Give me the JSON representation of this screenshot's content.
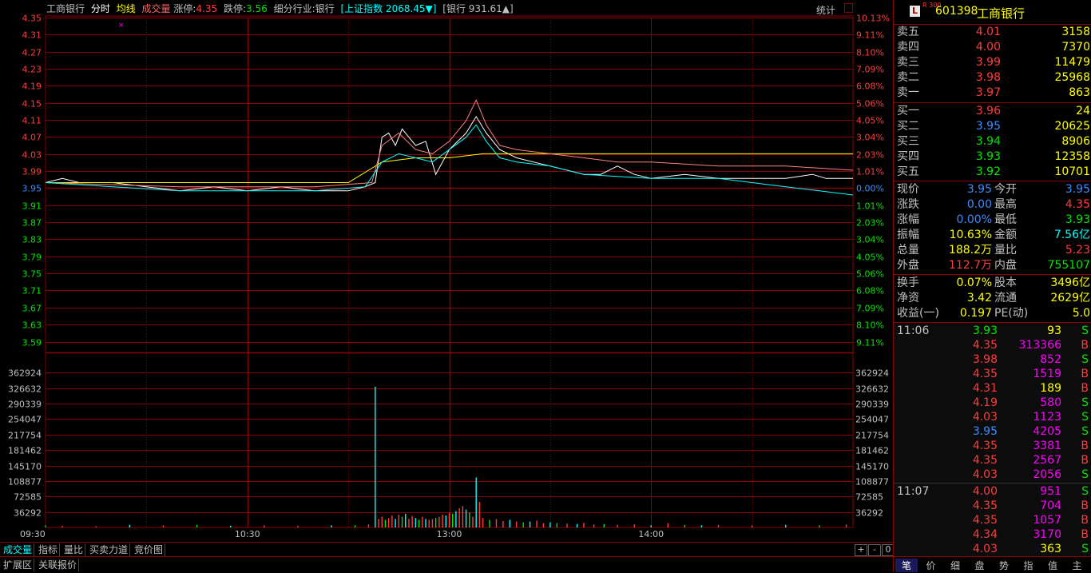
{
  "top": {
    "name": "工商银行",
    "mode": "分时",
    "avg_label": "均线",
    "vol_label": "成交量",
    "limit_up_label": "涨停:",
    "limit_up": "4.35",
    "limit_down_label": "跌停:",
    "limit_down": "3.56",
    "industry": "细分行业:银行",
    "index_text": "[上证指数 2068.45▼]",
    "sector_text": "[银行 931.61▲]",
    "stat_label": "统计"
  },
  "chart_data": {
    "type": "line",
    "title": "",
    "price_ticks": [
      "4.35",
      "4.31",
      "4.27",
      "4.23",
      "4.19",
      "4.15",
      "4.11",
      "4.07",
      "4.03",
      "3.99",
      "3.95",
      "3.91",
      "3.87",
      "3.83",
      "3.79",
      "3.75",
      "3.71",
      "3.67",
      "3.63",
      "3.59"
    ],
    "pct_ticks": [
      "10.13%",
      "9.11%",
      "8.10%",
      "7.09%",
      "6.08%",
      "5.06%",
      "4.05%",
      "3.04%",
      "2.03%",
      "1.01%",
      "0.00%",
      "1.01%",
      "2.03%",
      "3.04%",
      "4.05%",
      "5.06%",
      "6.08%",
      "7.09%",
      "8.10%",
      "9.11%"
    ],
    "vol_ticks": [
      "362924",
      "326632",
      "290339",
      "254047",
      "217754",
      "181462",
      "145170",
      "108877",
      "72585",
      "36292"
    ],
    "time_ticks": [
      "09:30",
      "10:30",
      "13:00",
      "14:00"
    ],
    "prev_close": 3.95,
    "price_range": [
      3.55,
      4.35
    ],
    "vol_range": [
      0,
      399216
    ],
    "minutes": 240,
    "series": [
      {
        "color": "#ffffff",
        "points": [
          [
            0,
            3.95
          ],
          [
            5,
            3.96
          ],
          [
            10,
            3.95
          ],
          [
            20,
            3.95
          ],
          [
            30,
            3.94
          ],
          [
            40,
            3.93
          ],
          [
            50,
            3.94
          ],
          [
            60,
            3.93
          ],
          [
            70,
            3.94
          ],
          [
            80,
            3.93
          ],
          [
            90,
            3.93
          ],
          [
            95,
            3.94
          ],
          [
            98,
            3.95
          ],
          [
            100,
            4.06
          ],
          [
            102,
            4.07
          ],
          [
            104,
            4.04
          ],
          [
            106,
            4.08
          ],
          [
            110,
            4.04
          ],
          [
            113,
            4.05
          ],
          [
            116,
            3.97
          ],
          [
            120,
            4.03
          ],
          [
            125,
            4.07
          ],
          [
            128,
            4.11
          ],
          [
            131,
            4.07
          ],
          [
            135,
            4.03
          ],
          [
            140,
            4.01
          ],
          [
            145,
            4.0
          ],
          [
            150,
            3.99
          ],
          [
            155,
            3.98
          ],
          [
            160,
            3.97
          ],
          [
            165,
            3.97
          ],
          [
            170,
            3.99
          ],
          [
            175,
            3.97
          ],
          [
            180,
            3.96
          ],
          [
            190,
            3.97
          ],
          [
            200,
            3.96
          ],
          [
            210,
            3.96
          ],
          [
            220,
            3.96
          ],
          [
            228,
            3.97
          ],
          [
            232,
            3.96
          ],
          [
            240,
            3.96
          ]
        ]
      },
      {
        "color": "#ffff00",
        "points": [
          [
            0,
            3.95
          ],
          [
            30,
            3.95
          ],
          [
            60,
            3.95
          ],
          [
            90,
            3.95
          ],
          [
            100,
            4.0
          ],
          [
            110,
            4.01
          ],
          [
            120,
            4.01
          ],
          [
            130,
            4.02
          ],
          [
            140,
            4.02
          ],
          [
            160,
            4.02
          ],
          [
            200,
            4.02
          ],
          [
            240,
            4.02
          ]
        ]
      },
      {
        "color": "#ff8080",
        "points": [
          [
            0,
            3.95
          ],
          [
            40,
            3.94
          ],
          [
            80,
            3.94
          ],
          [
            97,
            3.95
          ],
          [
            100,
            4.04
          ],
          [
            105,
            4.07
          ],
          [
            110,
            4.03
          ],
          [
            115,
            4.02
          ],
          [
            120,
            4.05
          ],
          [
            125,
            4.1
          ],
          [
            128,
            4.15
          ],
          [
            131,
            4.09
          ],
          [
            135,
            4.04
          ],
          [
            140,
            4.03
          ],
          [
            150,
            4.02
          ],
          [
            160,
            4.01
          ],
          [
            170,
            4.0
          ],
          [
            180,
            4.0
          ],
          [
            200,
            3.99
          ],
          [
            220,
            3.99
          ],
          [
            240,
            3.98
          ]
        ]
      },
      {
        "color": "#00ffff",
        "points": [
          [
            0,
            3.95
          ],
          [
            20,
            3.94
          ],
          [
            40,
            3.93
          ],
          [
            60,
            3.93
          ],
          [
            80,
            3.93
          ],
          [
            95,
            3.94
          ],
          [
            100,
            4.0
          ],
          [
            105,
            4.02
          ],
          [
            110,
            4.01
          ],
          [
            115,
            4.0
          ],
          [
            120,
            4.03
          ],
          [
            125,
            4.06
          ],
          [
            128,
            4.09
          ],
          [
            131,
            4.05
          ],
          [
            135,
            4.01
          ],
          [
            140,
            4.0
          ],
          [
            150,
            3.99
          ],
          [
            160,
            3.97
          ],
          [
            180,
            3.96
          ],
          [
            200,
            3.96
          ],
          [
            210,
            3.95
          ],
          [
            220,
            3.94
          ],
          [
            230,
            3.93
          ],
          [
            240,
            3.92
          ]
        ]
      }
    ],
    "volume": [
      [
        0,
        5000
      ],
      [
        5,
        4000
      ],
      [
        15,
        3000
      ],
      [
        25,
        6000
      ],
      [
        35,
        5000
      ],
      [
        45,
        6000
      ],
      [
        55,
        4000
      ],
      [
        65,
        5000
      ],
      [
        75,
        4000
      ],
      [
        85,
        5000
      ],
      [
        92,
        5000
      ],
      [
        96,
        7000
      ],
      [
        98,
        330000
      ],
      [
        99,
        20000
      ],
      [
        100,
        25000
      ],
      [
        101,
        18000
      ],
      [
        102,
        22000
      ],
      [
        103,
        28000
      ],
      [
        104,
        20000
      ],
      [
        105,
        30000
      ],
      [
        106,
        25000
      ],
      [
        107,
        32000
      ],
      [
        108,
        20000
      ],
      [
        109,
        27000
      ],
      [
        110,
        22000
      ],
      [
        111,
        18000
      ],
      [
        112,
        25000
      ],
      [
        113,
        20000
      ],
      [
        114,
        18000
      ],
      [
        115,
        20000
      ],
      [
        116,
        22000
      ],
      [
        117,
        25000
      ],
      [
        118,
        30000
      ],
      [
        119,
        28000
      ],
      [
        120,
        34000
      ],
      [
        121,
        32000
      ],
      [
        122,
        38000
      ],
      [
        123,
        45000
      ],
      [
        124,
        50000
      ],
      [
        125,
        42000
      ],
      [
        126,
        35000
      ],
      [
        127,
        25000
      ],
      [
        128,
        117000
      ],
      [
        129,
        60000
      ],
      [
        130,
        22000
      ],
      [
        132,
        18000
      ],
      [
        134,
        20000
      ],
      [
        136,
        15000
      ],
      [
        138,
        18000
      ],
      [
        140,
        14000
      ],
      [
        142,
        12000
      ],
      [
        144,
        14000
      ],
      [
        146,
        16000
      ],
      [
        148,
        10000
      ],
      [
        150,
        12000
      ],
      [
        152,
        10000
      ],
      [
        155,
        9000
      ],
      [
        158,
        8000
      ],
      [
        160,
        11000
      ],
      [
        163,
        7000
      ],
      [
        166,
        8000
      ],
      [
        170,
        6000
      ],
      [
        175,
        7000
      ],
      [
        180,
        5000
      ],
      [
        185,
        10000
      ],
      [
        190,
        6000
      ],
      [
        195,
        5000
      ],
      [
        200,
        6000
      ],
      [
        210,
        5000
      ],
      [
        220,
        6000
      ],
      [
        230,
        5000
      ],
      [
        238,
        7000
      ]
    ]
  },
  "panel": {
    "code": "601398",
    "name": "工商银行",
    "logo": "L",
    "tag": "R 300",
    "asks": [
      {
        "label": "卖五",
        "price": "4.01",
        "vol": "3158",
        "color": "red"
      },
      {
        "label": "卖四",
        "price": "4.00",
        "vol": "7370",
        "color": "red"
      },
      {
        "label": "卖三",
        "price": "3.99",
        "vol": "11479",
        "color": "red"
      },
      {
        "label": "卖二",
        "price": "3.98",
        "vol": "25968",
        "color": "red"
      },
      {
        "label": "卖一",
        "price": "3.97",
        "vol": "863",
        "color": "red"
      }
    ],
    "bids": [
      {
        "label": "买一",
        "price": "3.96",
        "vol": "24",
        "color": "red"
      },
      {
        "label": "买二",
        "price": "3.95",
        "vol": "20625",
        "color": "blue"
      },
      {
        "label": "买三",
        "price": "3.94",
        "vol": "8906",
        "color": "green"
      },
      {
        "label": "买四",
        "price": "3.93",
        "vol": "12358",
        "color": "green"
      },
      {
        "label": "买五",
        "price": "3.92",
        "vol": "10701",
        "color": "green"
      }
    ],
    "quote1": [
      {
        "l1": "现价",
        "v1": "3.95",
        "c1": "blue",
        "l2": "今开",
        "v2": "3.95",
        "c2": "blue"
      },
      {
        "l1": "涨跌",
        "v1": "0.00",
        "c1": "blue",
        "l2": "最高",
        "v2": "4.35",
        "c2": "red"
      },
      {
        "l1": "涨幅",
        "v1": "0.00%",
        "c1": "blue",
        "l2": "最低",
        "v2": "3.93",
        "c2": "green"
      },
      {
        "l1": "振幅",
        "v1": "10.63%",
        "c1": "yellow",
        "l2": "金额",
        "v2": "7.56亿",
        "c2": "cyan"
      },
      {
        "l1": "总量",
        "v1": "188.2万",
        "c1": "yellow",
        "l2": "量比",
        "v2": "5.23",
        "c2": "red"
      },
      {
        "l1": "外盘",
        "v1": "112.7万",
        "c1": "red",
        "l2": "内盘",
        "v2": "755107",
        "c2": "green"
      }
    ],
    "quote2": [
      {
        "l1": "换手",
        "v1": "0.07%",
        "c1": "yellow",
        "l2": "股本",
        "v2": "3496亿",
        "c2": "yellow"
      },
      {
        "l1": "净资",
        "v1": "3.42",
        "c1": "yellow",
        "l2": "流通",
        "v2": "2629亿",
        "c2": "yellow"
      },
      {
        "l1": "收益(一)",
        "v1": "0.197",
        "c1": "yellow",
        "l2": "PE(动)",
        "v2": "5.0",
        "c2": "yellow"
      }
    ],
    "ticks": [
      {
        "time": "11:06",
        "price": "3.93",
        "pc": "green",
        "vol": "93",
        "vc": "yellow",
        "bs": "S",
        "bc": "green"
      },
      {
        "time": "",
        "price": "4.35",
        "pc": "red",
        "vol": "313366",
        "vc": "magenta",
        "bs": "B",
        "bc": "red"
      },
      {
        "time": "",
        "price": "3.98",
        "pc": "red",
        "vol": "852",
        "vc": "magenta",
        "bs": "S",
        "bc": "green"
      },
      {
        "time": "",
        "price": "4.35",
        "pc": "red",
        "vol": "1519",
        "vc": "magenta",
        "bs": "B",
        "bc": "red"
      },
      {
        "time": "",
        "price": "4.31",
        "pc": "red",
        "vol": "189",
        "vc": "yellow",
        "bs": "B",
        "bc": "red"
      },
      {
        "time": "",
        "price": "4.19",
        "pc": "red",
        "vol": "580",
        "vc": "magenta",
        "bs": "S",
        "bc": "green"
      },
      {
        "time": "",
        "price": "4.03",
        "pc": "red",
        "vol": "1123",
        "vc": "magenta",
        "bs": "S",
        "bc": "green"
      },
      {
        "time": "",
        "price": "3.95",
        "pc": "blue",
        "vol": "4205",
        "vc": "magenta",
        "bs": "S",
        "bc": "green"
      },
      {
        "time": "",
        "price": "4.35",
        "pc": "red",
        "vol": "3381",
        "vc": "magenta",
        "bs": "B",
        "bc": "red"
      },
      {
        "time": "",
        "price": "4.35",
        "pc": "red",
        "vol": "2567",
        "vc": "magenta",
        "bs": "B",
        "bc": "red"
      },
      {
        "time": "",
        "price": "4.03",
        "pc": "red",
        "vol": "2056",
        "vc": "magenta",
        "bs": "S",
        "bc": "green"
      },
      {
        "time": "11:07",
        "price": "4.00",
        "pc": "red",
        "vol": "951",
        "vc": "magenta",
        "bs": "S",
        "bc": "green"
      },
      {
        "time": "",
        "price": "4.35",
        "pc": "red",
        "vol": "704",
        "vc": "magenta",
        "bs": "B",
        "bc": "red"
      },
      {
        "time": "",
        "price": "4.35",
        "pc": "red",
        "vol": "1057",
        "vc": "magenta",
        "bs": "B",
        "bc": "red"
      },
      {
        "time": "",
        "price": "4.34",
        "pc": "red",
        "vol": "3170",
        "vc": "magenta",
        "bs": "B",
        "bc": "red"
      },
      {
        "time": "",
        "price": "4.03",
        "pc": "red",
        "vol": "363",
        "vc": "yellow",
        "bs": "S",
        "bc": "green"
      }
    ],
    "tabs": [
      "笔",
      "价",
      "细",
      "盘",
      "势",
      "指",
      "值",
      "主"
    ]
  },
  "bottom": {
    "tabs": [
      "成交量",
      "指标",
      "量比",
      "买卖力道",
      "竞价图"
    ],
    "tabs2": [
      "扩展区",
      "关联报价"
    ],
    "zoom": [
      "+",
      "-",
      "0"
    ]
  }
}
